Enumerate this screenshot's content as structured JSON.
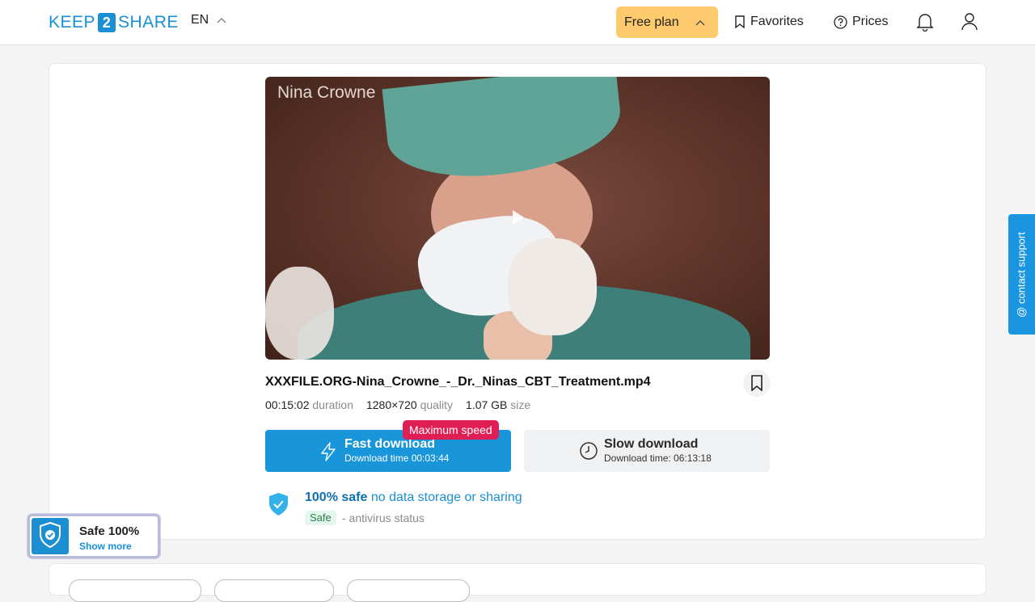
{
  "header": {
    "logo_left": "KEEP",
    "logo_num": "2",
    "logo_right": "SHARE",
    "language": "EN",
    "plan_label": "Free plan",
    "favorites_label": "Favorites",
    "prices_label": "Prices"
  },
  "file": {
    "preview_watermark": "Nina Crowne",
    "name": "XXXFILE.ORG-Nina_Crowne_-_Dr._Ninas_CBT_Treatment.mp4",
    "duration": "00:15:02",
    "duration_label": "duration",
    "quality": "1280×720",
    "quality_label": "quality",
    "size": "1.07 GB",
    "size_label": "size"
  },
  "downloads": {
    "fast_title": "Fast download",
    "fast_time": "Download time 00:03:44",
    "max_badge": "Maximum speed",
    "slow_title": "Slow download",
    "slow_time": "Download time: 06:13:18"
  },
  "safety": {
    "headline_bold": "100% safe",
    "headline_rest": " no data storage or sharing",
    "chip": "Safe",
    "status": "- antivirus status"
  },
  "support_tab": "@ contact support",
  "safe_widget": {
    "title": "Safe 100%",
    "link": "Show more"
  },
  "colors": {
    "brand_blue": "#1896d9",
    "plan_yellow": "#fdcb6e",
    "badge_red": "#e01e56"
  }
}
